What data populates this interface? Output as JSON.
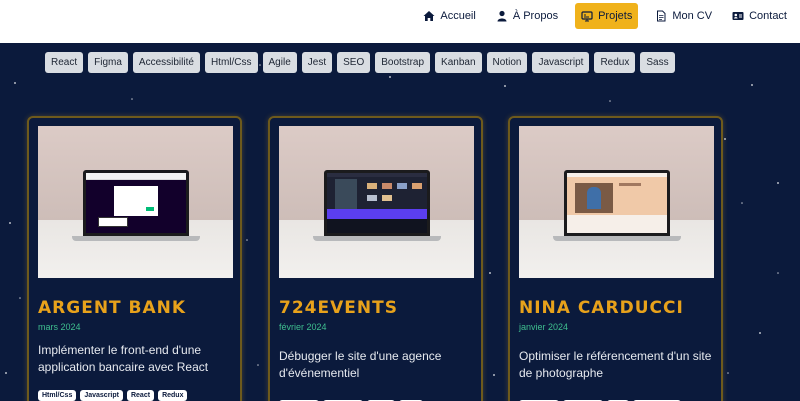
{
  "nav": {
    "items": [
      {
        "label": "Accueil",
        "icon": "home-icon"
      },
      {
        "label": "À Propos",
        "icon": "user-icon"
      },
      {
        "label": "Projets",
        "icon": "projects-icon",
        "active": true
      },
      {
        "label": "Mon CV",
        "icon": "document-icon"
      },
      {
        "label": "Contact",
        "icon": "contact-card-icon"
      }
    ]
  },
  "filters": [
    "React",
    "Figma",
    "Accessibilité",
    "Html/Css",
    "Agile",
    "Jest",
    "SEO",
    "Bootstrap",
    "Kanban",
    "Notion",
    "Javascript",
    "Redux",
    "Sass"
  ],
  "projects": [
    {
      "title": "ARGENT BANK",
      "date": "mars 2024",
      "description": "Implémenter le front-end d'une application bancaire avec React",
      "tags": [
        "Html/Css",
        "Javascript",
        "React",
        "Redux"
      ]
    },
    {
      "title": "724EVENTS",
      "date": "février 2024",
      "description": "Débugger le site d'une agence d'événementiel",
      "tags": []
    },
    {
      "title": "NINA CARDUCCI",
      "date": "janvier 2024",
      "description": "Optimiser le référencement d'un site de photographe",
      "tags": []
    }
  ],
  "colors": {
    "background": "#0b1a3c",
    "accent": "#f0b21b",
    "title": "#e8a21b",
    "date": "#3fbf8f"
  }
}
